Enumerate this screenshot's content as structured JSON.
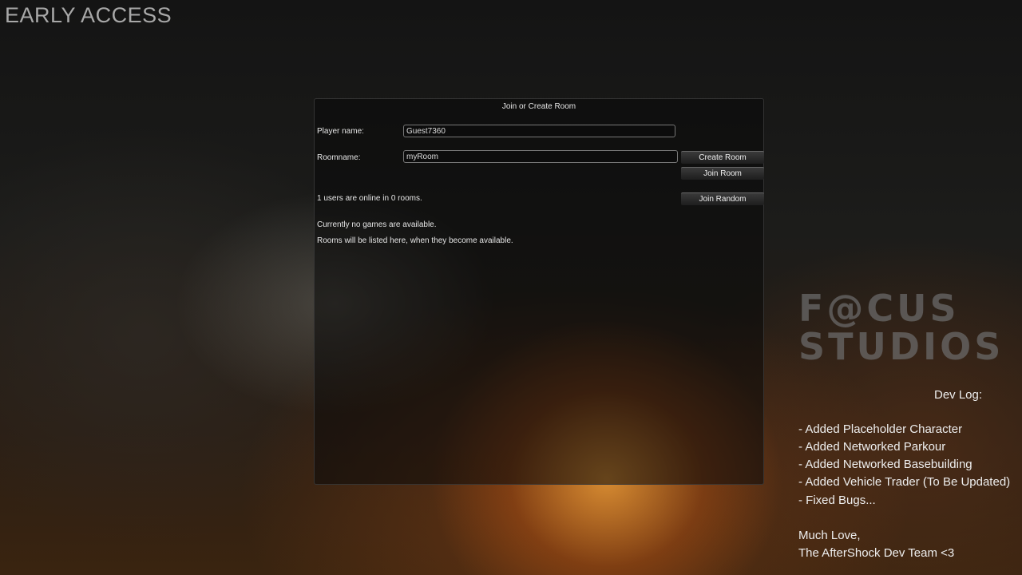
{
  "banner": "EARLY ACCESS",
  "dialog": {
    "title": "Join or Create Room",
    "player_label": "Player name:",
    "player_value": "Guest7360",
    "room_label": "Roomname:",
    "room_value": "myRoom",
    "create": "Create Room",
    "join": "Join Room",
    "join_random": "Join Random",
    "status": "1 users are online in 0 rooms.",
    "no_games": "Currently no games are available.",
    "rooms_hint": "Rooms will be listed here, when they become available."
  },
  "logo": {
    "line1": "F@CUS",
    "line2": "STUDIOS"
  },
  "devlog": {
    "title": "Dev Log:",
    "items": [
      "- Added Placeholder Character",
      "- Added Networked Parkour",
      "- Added Networked Basebuilding",
      "- Added Vehicle Trader (To Be Updated)",
      "- Fixed Bugs..."
    ],
    "sign1": "Much Love,",
    "sign2": "The AfterShock Dev Team <3"
  }
}
